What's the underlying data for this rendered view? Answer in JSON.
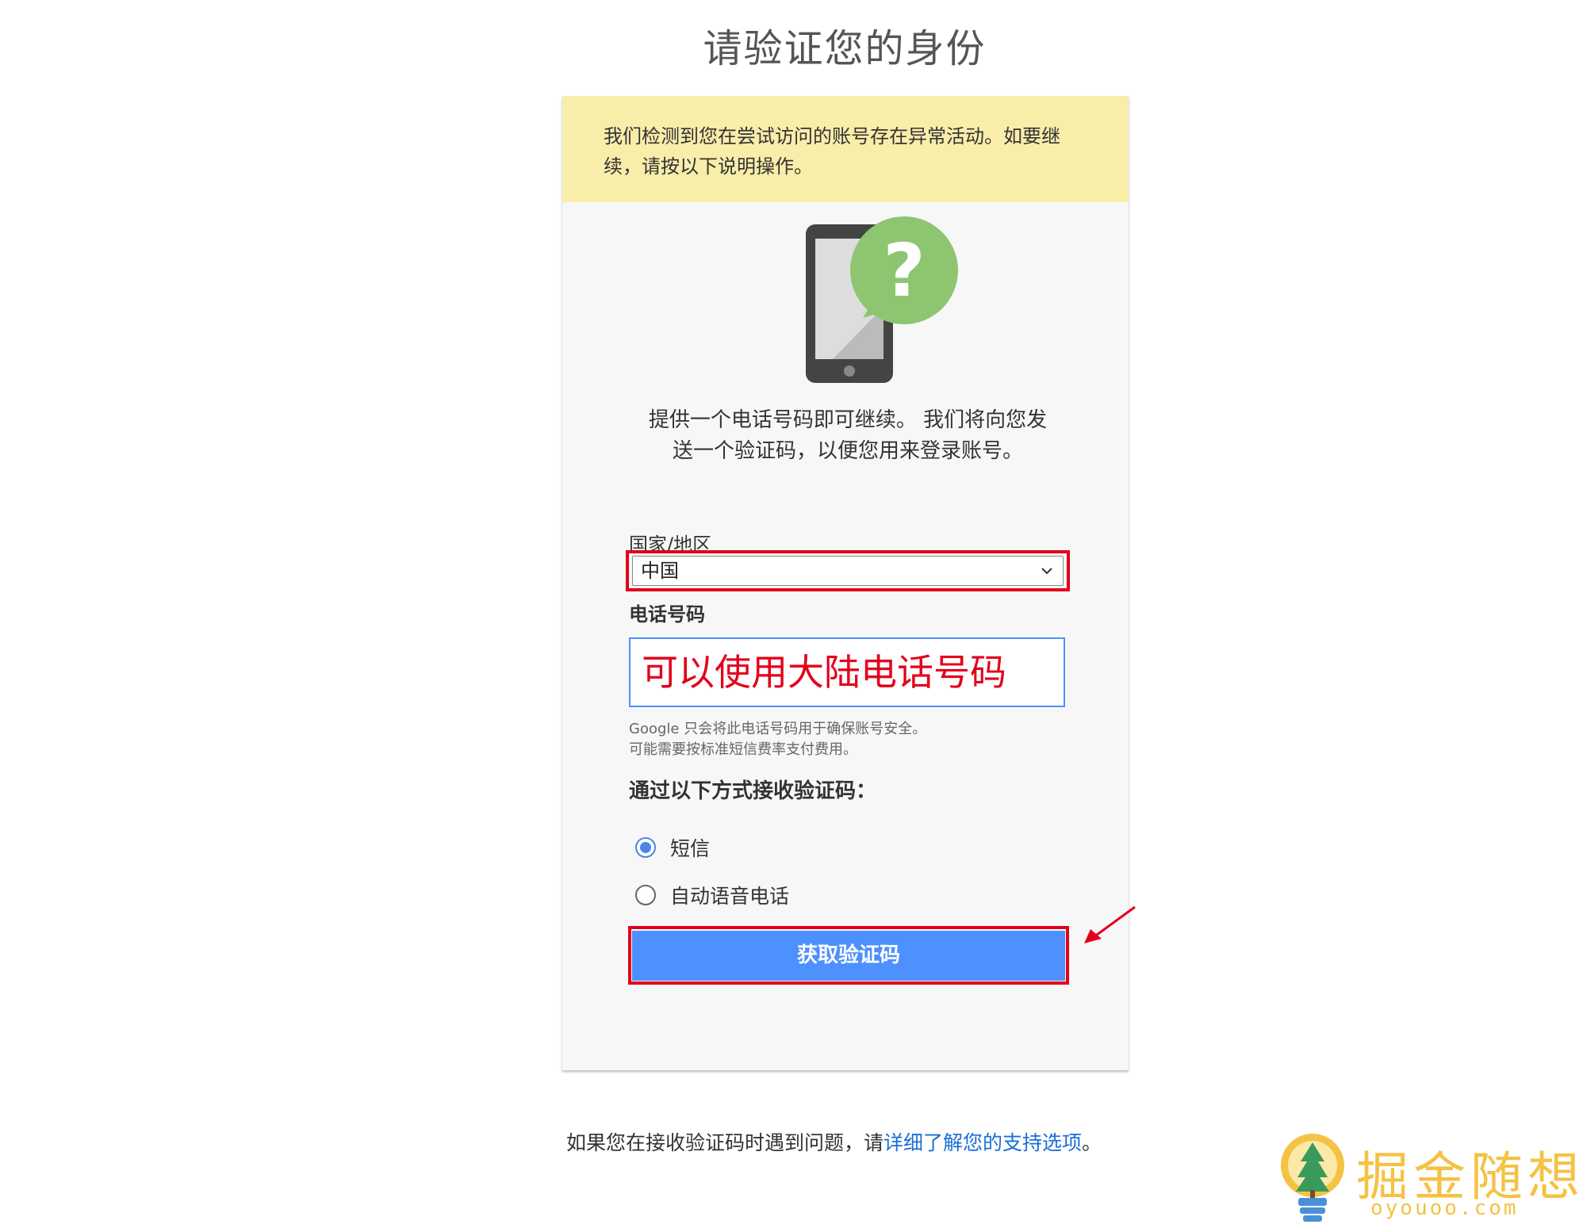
{
  "page_title": "请验证您的身份",
  "warning_text": "我们检测到您在尝试访问的账号存在异常活动。如要继续，请按以下说明操作。",
  "illustration_icon": "phone-question-icon",
  "intro_text": "提供一个电话号码即可继续。 我们将向您发送一个验证码，以便您用来登录账号。",
  "country": {
    "label": "国家/地区",
    "selected": "中国"
  },
  "phone": {
    "label": "电话号码",
    "value": "可以使用大陆电话号码"
  },
  "notes": [
    "Google 只会将此电话号码用于确保账号安全。",
    "可能需要按标准短信费率支付费用。"
  ],
  "method": {
    "label": "通过以下方式接收验证码：",
    "options": [
      {
        "label": "短信",
        "checked": true
      },
      {
        "label": "自动语音电话",
        "checked": false
      }
    ]
  },
  "submit_label": "获取验证码",
  "footer": {
    "prefix": "如果您在接收验证码时遇到问题，请",
    "link": "详细了解您的支持选项",
    "suffix": "。"
  },
  "watermark": {
    "title": "掘金随想",
    "url": "oyouoo.com"
  },
  "colors": {
    "warning_bg": "#f9edaa",
    "primary": "#4d90fe",
    "highlight": "#e3001b",
    "link": "#1a6ed8",
    "watermark": "#f4c244"
  }
}
